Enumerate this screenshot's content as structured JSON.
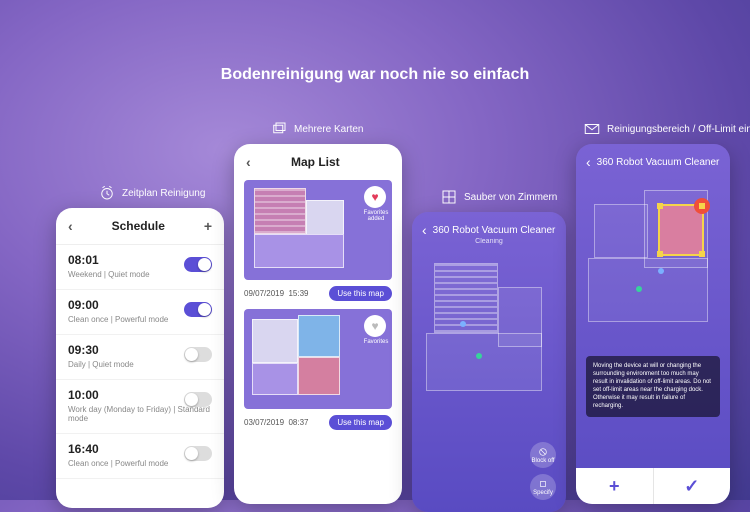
{
  "headline": "Bodenreinigung war noch nie so einfach",
  "sections": {
    "schedule": "Zeitplan Reinigung",
    "maps": "Mehrere Karten",
    "rooms": "Sauber von Zimmern",
    "offlimit": "Reinigungsbereich / Off-Limit einstellen"
  },
  "schedule": {
    "title": "Schedule",
    "items": [
      {
        "time": "08:01",
        "sub": "Weekend  |  Quiet mode",
        "on": true
      },
      {
        "time": "09:00",
        "sub": "Clean once  |  Powerful mode",
        "on": true
      },
      {
        "time": "09:30",
        "sub": "Daily  |  Quiet mode",
        "on": false
      },
      {
        "time": "10:00",
        "sub": "Work day (Monday to Friday)  |  Standard mode",
        "on": false
      },
      {
        "time": "16:40",
        "sub": "Clean once  |  Powerful mode",
        "on": false
      }
    ]
  },
  "maps": {
    "title": "Map List",
    "fav_added": "Favorites added",
    "fav_label": "Favorites",
    "use_label": "Use this map",
    "items": [
      {
        "date": "09/07/2019",
        "time": "15:39",
        "fav": true
      },
      {
        "date": "03/07/2019",
        "time": "08:37",
        "fav": false
      }
    ]
  },
  "rooms": {
    "title": "360 Robot Vacuum Cleaner",
    "status": "Cleaning",
    "btn_blockoff": "Block off",
    "btn_specify": "Specify"
  },
  "offlimit": {
    "title": "360 Robot Vacuum Cleaner",
    "note": "Moving the device at will or changing the surrounding environment too much may result in invalidation of off-limit areas. Do not set off-limit areas near the charging dock. Otherwise it may result in failure of recharging.",
    "plus": "+",
    "check": "✓"
  }
}
